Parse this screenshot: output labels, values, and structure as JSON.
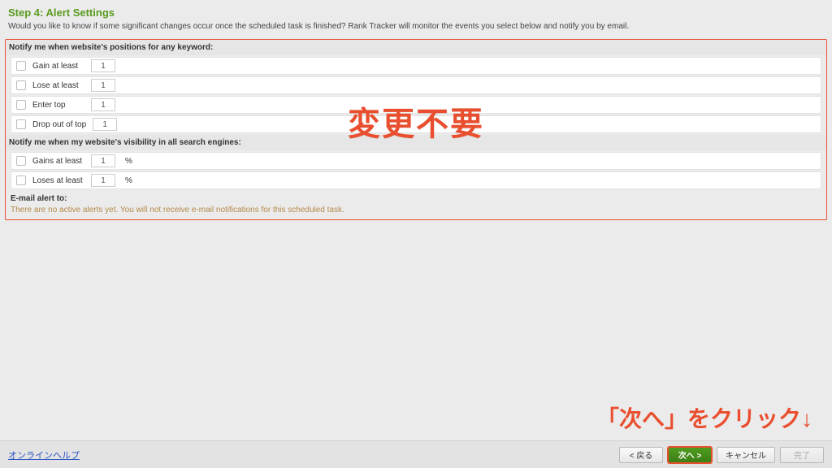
{
  "header": {
    "title": "Step 4: Alert Settings",
    "subtitle": "Would you like to know if some significant changes occur once the scheduled task is finished? Rank Tracker will monitor the events you select below and notify you by email."
  },
  "sections": {
    "positions_label": "Notify me when website's positions for any keyword:",
    "visibility_label": "Notify me when my website's visibility in all search engines:"
  },
  "rows": {
    "gain": {
      "label": "Gain at least",
      "value": "1",
      "unit": ""
    },
    "lose": {
      "label": "Lose at least",
      "value": "1",
      "unit": ""
    },
    "enter": {
      "label": "Enter top",
      "value": "1",
      "unit": ""
    },
    "drop": {
      "label": "Drop out of top",
      "value": "1",
      "unit": ""
    },
    "vgain": {
      "label": "Gains at least",
      "value": "1",
      "unit": "%"
    },
    "vlose": {
      "label": "Loses at least",
      "value": "1",
      "unit": "%"
    }
  },
  "email": {
    "title": "E-mail alert to:",
    "text": "There are no active alerts yet. You will not receive e-mail notifications for this scheduled task."
  },
  "annotations": {
    "center": "変更不要",
    "bottom": "「次へ」をクリック↓"
  },
  "footer": {
    "help": "オンラインヘルプ",
    "back": "< 戻る",
    "next": "次へ >",
    "cancel": "キャンセル",
    "finish": "完了"
  }
}
